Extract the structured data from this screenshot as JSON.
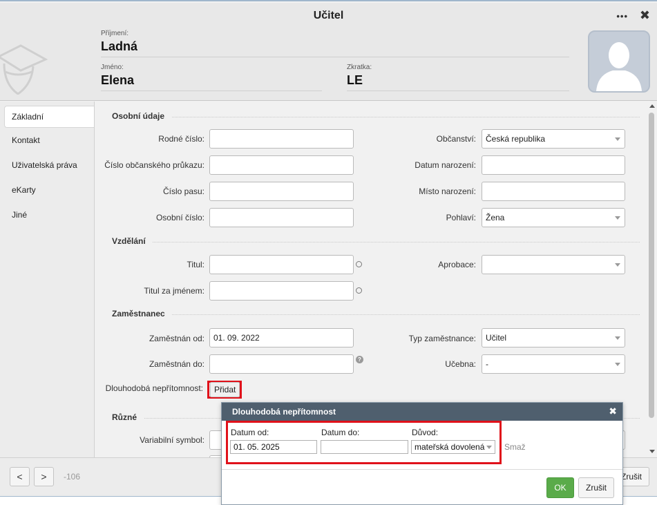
{
  "window": {
    "title": "Učitel",
    "menu_label": "•••",
    "close_label": "✖"
  },
  "header": {
    "surname_label": "Příjmení:",
    "surname": "Ladná",
    "firstname_label": "Jméno:",
    "firstname": "Elena",
    "abbr_label": "Zkratka:",
    "abbr": "LE"
  },
  "sidebar": {
    "items": [
      {
        "label": "Základní",
        "active": true
      },
      {
        "label": "Kontakt"
      },
      {
        "label": "Uživatelská práva"
      },
      {
        "label": "eKarty"
      },
      {
        "label": "Jiné"
      }
    ]
  },
  "personal": {
    "heading": "Osobní údaje",
    "birth_number_label": "Rodné číslo:",
    "birth_number": "",
    "id_card_label": "Číslo občanského průkazu:",
    "id_card": "",
    "passport_label": "Číslo pasu:",
    "passport": "",
    "personal_no_label": "Osobní číslo:",
    "personal_no": "",
    "citizenship_label": "Občanství:",
    "citizenship": "Česká republika",
    "birth_date_label": "Datum narození:",
    "birth_date": "",
    "birth_place_label": "Místo narození:",
    "birth_place": "",
    "gender_label": "Pohlaví:",
    "gender": "Žena"
  },
  "education": {
    "heading": "Vzdělání",
    "title_label": "Titul:",
    "title": "",
    "title_after_label": "Titul za jménem:",
    "title_after": "",
    "approbation_label": "Aprobace:",
    "approbation": ""
  },
  "employee": {
    "heading": "Zaměstnanec",
    "from_label": "Zaměstnán od:",
    "from": "01. 09. 2022",
    "to_label": "Zaměstnán do:",
    "to": "",
    "type_label": "Typ zaměstnance:",
    "type": "Učitel",
    "room_label": "Učebna:",
    "room": "-",
    "absence_label": "Dlouhodobá nepřítomnost:",
    "add_button": "Přidat"
  },
  "misc": {
    "heading": "Různé",
    "variable_symbol_label": "Variabilní symbol:"
  },
  "footer": {
    "prev": "<",
    "next": ">",
    "counter": "-106",
    "cancel_partial": "Zrušit"
  },
  "dialog": {
    "title": "Dlouhodobá nepřítomnost",
    "close": "✖",
    "from_label": "Datum od:",
    "from": "01. 05. 2025",
    "to_label": "Datum do:",
    "to": "",
    "reason_label": "Důvod:",
    "reason": "mateřská dovolená",
    "delete_link": "Smaž",
    "ok": "OK",
    "cancel": "Zrušit"
  },
  "colors": {
    "highlight": "#e0111a",
    "ok_button": "#5aab4a",
    "dialog_header": "#4f5f6e"
  }
}
